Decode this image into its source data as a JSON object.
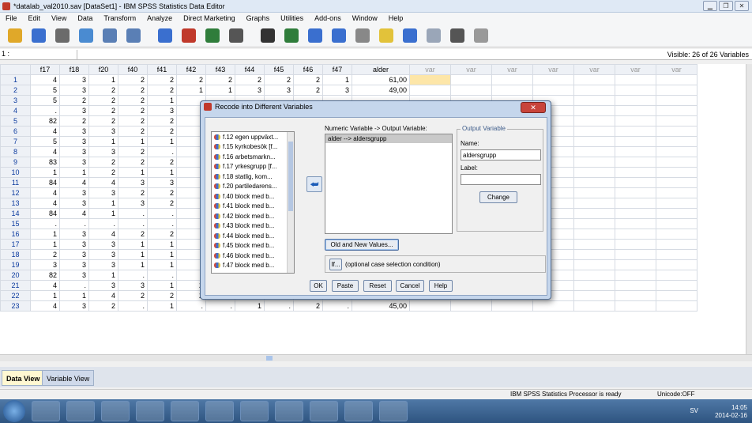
{
  "window": {
    "title": "*datalab_val2010.sav [DataSet1] - IBM SPSS Statistics Data Editor",
    "controls": [
      "▁",
      "❐",
      "✕"
    ]
  },
  "menu": [
    "File",
    "Edit",
    "View",
    "Data",
    "Transform",
    "Analyze",
    "Direct Marketing",
    "Graphs",
    "Utilities",
    "Add-ons",
    "Window",
    "Help"
  ],
  "toolbar": {
    "icons": [
      {
        "name": "open-icon",
        "color": "#e0a829"
      },
      {
        "name": "save-icon",
        "color": "#3a6fcf"
      },
      {
        "name": "print-icon",
        "color": "#6b6b6b"
      },
      {
        "name": "dialog-recall-icon",
        "color": "#4a8bd1"
      },
      {
        "name": "undo-icon",
        "color": "#5a7fb5"
      },
      {
        "name": "redo-icon",
        "color": "#5a7fb5"
      },
      {
        "name": "goto-case-icon",
        "color": "#3a6fcf"
      },
      {
        "name": "goto-variable-icon",
        "color": "#c0392b"
      },
      {
        "name": "variables-icon",
        "color": "#2f7d3b"
      },
      {
        "name": "run-descriptives-icon",
        "color": "#555555"
      },
      {
        "name": "find-icon",
        "color": "#333333"
      },
      {
        "name": "insert-cases-icon",
        "color": "#2f7d3b"
      },
      {
        "name": "insert-variable-icon",
        "color": "#3a6fcf"
      },
      {
        "name": "split-file-icon",
        "color": "#3a6fcf"
      },
      {
        "name": "weight-cases-icon",
        "color": "#888888"
      },
      {
        "name": "select-cases-icon",
        "color": "#e2c23a"
      },
      {
        "name": "value-labels-icon",
        "color": "#3a6fcf"
      },
      {
        "name": "use-variable-sets-icon",
        "color": "#9aa6b8"
      },
      {
        "name": "show-all-variables-icon",
        "color": "#555555"
      },
      {
        "name": "spelling-icon",
        "color": "#999999"
      }
    ]
  },
  "cellbar": {
    "ref": "1 :",
    "visible": "Visible: 26 of 26 Variables"
  },
  "grid": {
    "columns": [
      "f17",
      "f18",
      "f20",
      "f40",
      "f41",
      "f42",
      "f43",
      "f44",
      "f45",
      "f46",
      "f47",
      "alder",
      "var",
      "var",
      "var",
      "var",
      "var",
      "var",
      "var"
    ],
    "rows": [
      [
        "1",
        "4",
        "3",
        "1",
        "2",
        "2",
        "2",
        "2",
        "2",
        "2",
        "2",
        "1",
        "61,00"
      ],
      [
        "2",
        "5",
        "3",
        "2",
        "2",
        "2",
        "1",
        "1",
        "3",
        "3",
        "2",
        "3",
        "49,00"
      ],
      [
        "3",
        "5",
        "2",
        "2",
        "2",
        "1",
        "",
        "",
        "",
        "",
        "",
        "",
        ""
      ],
      [
        "4",
        ".",
        "3",
        "2",
        "2",
        "3",
        "",
        "",
        "",
        "",
        "",
        "",
        ""
      ],
      [
        "5",
        "82",
        "2",
        "2",
        "2",
        "2",
        "",
        "",
        "",
        "",
        "",
        "",
        ""
      ],
      [
        "6",
        "4",
        "3",
        "3",
        "2",
        "2",
        "",
        "",
        "",
        "",
        "",
        "",
        ""
      ],
      [
        "7",
        "5",
        "3",
        "1",
        "1",
        "1",
        "",
        "",
        "",
        "",
        "",
        "",
        ""
      ],
      [
        "8",
        "4",
        "3",
        "3",
        "2",
        ".",
        "",
        "",
        "",
        "",
        "",
        "",
        ""
      ],
      [
        "9",
        "83",
        "3",
        "2",
        "2",
        "2",
        "",
        "",
        "",
        "",
        "",
        "",
        ""
      ],
      [
        "10",
        "1",
        "1",
        "2",
        "1",
        "1",
        "",
        "",
        "",
        "",
        "",
        "",
        ""
      ],
      [
        "11",
        "84",
        "4",
        "4",
        "3",
        "3",
        "",
        "",
        "",
        "",
        "",
        "",
        ""
      ],
      [
        "12",
        "4",
        "3",
        "3",
        "2",
        "2",
        "",
        "",
        "",
        "",
        "",
        "",
        ""
      ],
      [
        "13",
        "4",
        "3",
        "1",
        "3",
        "2",
        "",
        "",
        "",
        "",
        "",
        "",
        ""
      ],
      [
        "14",
        "84",
        "4",
        "1",
        ".",
        ".",
        "",
        "",
        "",
        "",
        "",
        "",
        ""
      ],
      [
        "15",
        ".",
        ".",
        ".",
        ".",
        ".",
        "",
        "",
        "",
        "",
        "",
        "",
        ""
      ],
      [
        "16",
        "1",
        "3",
        "4",
        "2",
        "2",
        "",
        "",
        "",
        "",
        "",
        "",
        ""
      ],
      [
        "17",
        "1",
        "3",
        "3",
        "1",
        "1",
        "",
        "",
        "",
        "",
        "",
        "",
        ""
      ],
      [
        "18",
        "2",
        "3",
        "3",
        "1",
        "1",
        "",
        "",
        "",
        "",
        "",
        "",
        ""
      ],
      [
        "19",
        "3",
        "3",
        "3",
        "1",
        "1",
        "",
        "",
        "",
        "",
        "",
        "",
        ""
      ],
      [
        "20",
        "82",
        "3",
        "1",
        ".",
        ".",
        ".",
        ".",
        ".",
        ".",
        ".",
        ".",
        "47,00"
      ],
      [
        "21",
        "4",
        ".",
        "3",
        "3",
        "1",
        "2",
        "1",
        ".",
        "1",
        "2",
        "1",
        "22,00"
      ],
      [
        "22",
        "1",
        "1",
        "4",
        "2",
        "2",
        "2",
        "1",
        "1",
        "2",
        "3",
        "3",
        "64,00"
      ],
      [
        "23",
        "4",
        "3",
        "2",
        ".",
        "1",
        ".",
        ".",
        "1",
        ".",
        "2",
        ".",
        "45,00"
      ]
    ]
  },
  "tabs": {
    "data_view": "Data View",
    "variable_view": "Variable View"
  },
  "status": {
    "processor": "IBM SPSS Statistics Processor is ready",
    "unicode": "Unicode:OFF"
  },
  "taskbar": {
    "buttons": [
      "explorer",
      "outlook",
      "chrome",
      "calculator",
      "acrobat",
      "word",
      "sonos",
      "snipping",
      "spss",
      "powerpoint",
      "skype"
    ],
    "tray_lang": "SV",
    "time": "14:05",
    "date": "2014-02-16"
  },
  "dialog": {
    "title": "Recode into Different Variables",
    "close": "✕",
    "source_vars": [
      "f.12 egen uppväxt...",
      "f.15 kyrkobesök [f...",
      "f.16 arbetsmarkn...",
      "f.17 yrkesgrupp [f...",
      "f.18 statlig, kom...",
      "f.20 partiledarens...",
      "f.40 block med b...",
      "f.41 block med b...",
      "f.42 block med b...",
      "f.43 block med b...",
      "f.44 block med b...",
      "f.45 block med b...",
      "f.46 block med b...",
      "f.47 block med b..."
    ],
    "arrow": "⮨",
    "numeric_label": "Numeric Variable -> Output Variable:",
    "mapping": "alder --> aldersgrupp",
    "output_group": "Output Variable",
    "name_label": "Name:",
    "name_value": "aldersgrupp",
    "label_label": "Label:",
    "label_value": "",
    "change": "Change",
    "old_new": "Old and New Values...",
    "if_btn": "If...",
    "if_text": "(optional case selection condition)",
    "ok": "OK",
    "paste": "Paste",
    "reset": "Reset",
    "cancel": "Cancel",
    "help": "Help"
  }
}
